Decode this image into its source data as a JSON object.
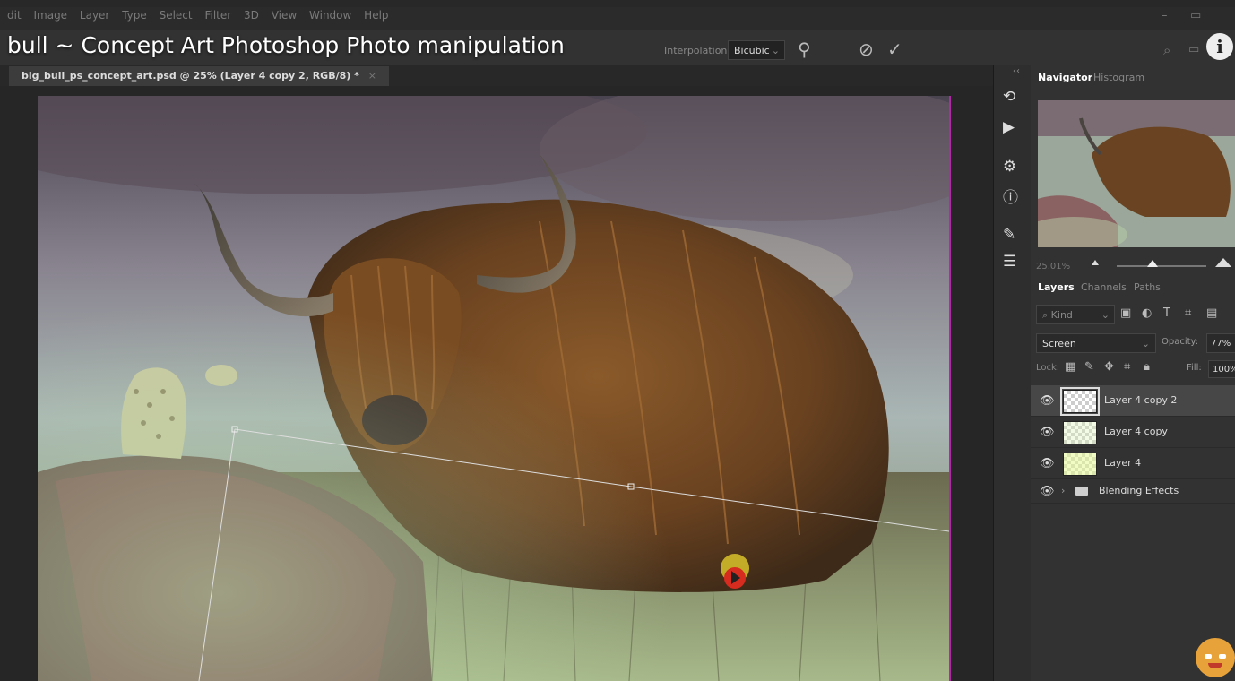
{
  "menu": [
    "dit",
    "Image",
    "Layer",
    "Type",
    "Select",
    "Filter",
    "3D",
    "View",
    "Window",
    "Help"
  ],
  "video_title": "bull ~ Concept Art Photoshop Photo manipulation",
  "options_bar": {
    "interpolation_label": "Interpolation:",
    "interpolation_value": "Bicubic"
  },
  "document_tab": {
    "title": "big_bull_ps_concept_art.psd @ 25% (Layer 4 copy 2, RGB/8) *",
    "close": "×"
  },
  "navigator": {
    "tabs": [
      "Navigator",
      "Histogram"
    ],
    "active_tab": "Navigator",
    "zoom": "25.01%"
  },
  "layers_panel": {
    "tabs": [
      "Layers",
      "Channels",
      "Paths"
    ],
    "active_tab": "Layers",
    "kind_placeholder": "Kind",
    "blend_mode": "Screen",
    "opacity_label": "Opacity:",
    "opacity": "77%",
    "lock_label": "Lock:",
    "fill_label": "Fill:",
    "fill": "100%",
    "layers": [
      {
        "name": "Layer 4 copy 2",
        "visible": true,
        "selected": true
      },
      {
        "name": "Layer 4 copy",
        "visible": true,
        "selected": false
      },
      {
        "name": "Layer 4",
        "visible": true,
        "selected": false
      }
    ],
    "group": {
      "name": "Blending Effects",
      "visible": true
    }
  },
  "colors": {
    "app_bg": "#282828",
    "panel_bg": "#323232",
    "canvas_edge": "#b02aa8",
    "cursor_red": "#d62b1f",
    "cursor_yellow": "#d8c22a"
  }
}
